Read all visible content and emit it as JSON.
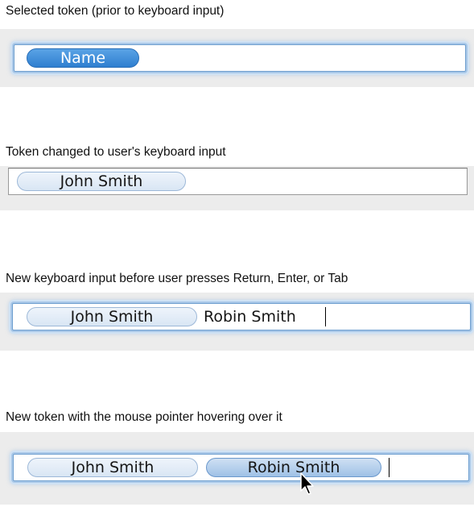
{
  "sections": [
    {
      "caption": "Selected token (prior to keyboard input)",
      "tokens": [
        "Name"
      ]
    },
    {
      "caption": "Token changed to user's keyboard input",
      "tokens": [
        "John Smith"
      ]
    },
    {
      "caption": "New keyboard input before user presses Return, Enter, or Tab",
      "tokens": [
        "John Smith"
      ],
      "typed_text": "Robin Smith"
    },
    {
      "caption": "New token with the mouse pointer hovering over it",
      "tokens": [
        "John Smith",
        "Robin Smith"
      ]
    }
  ],
  "colors": {
    "focus_ring": "#a9c8e8",
    "token_selected": "#3a8ad8",
    "token_normal": "#e3ecf7",
    "token_hover": "#b4cfec"
  },
  "icons": {
    "pointer": "arrow-pointer-icon"
  }
}
